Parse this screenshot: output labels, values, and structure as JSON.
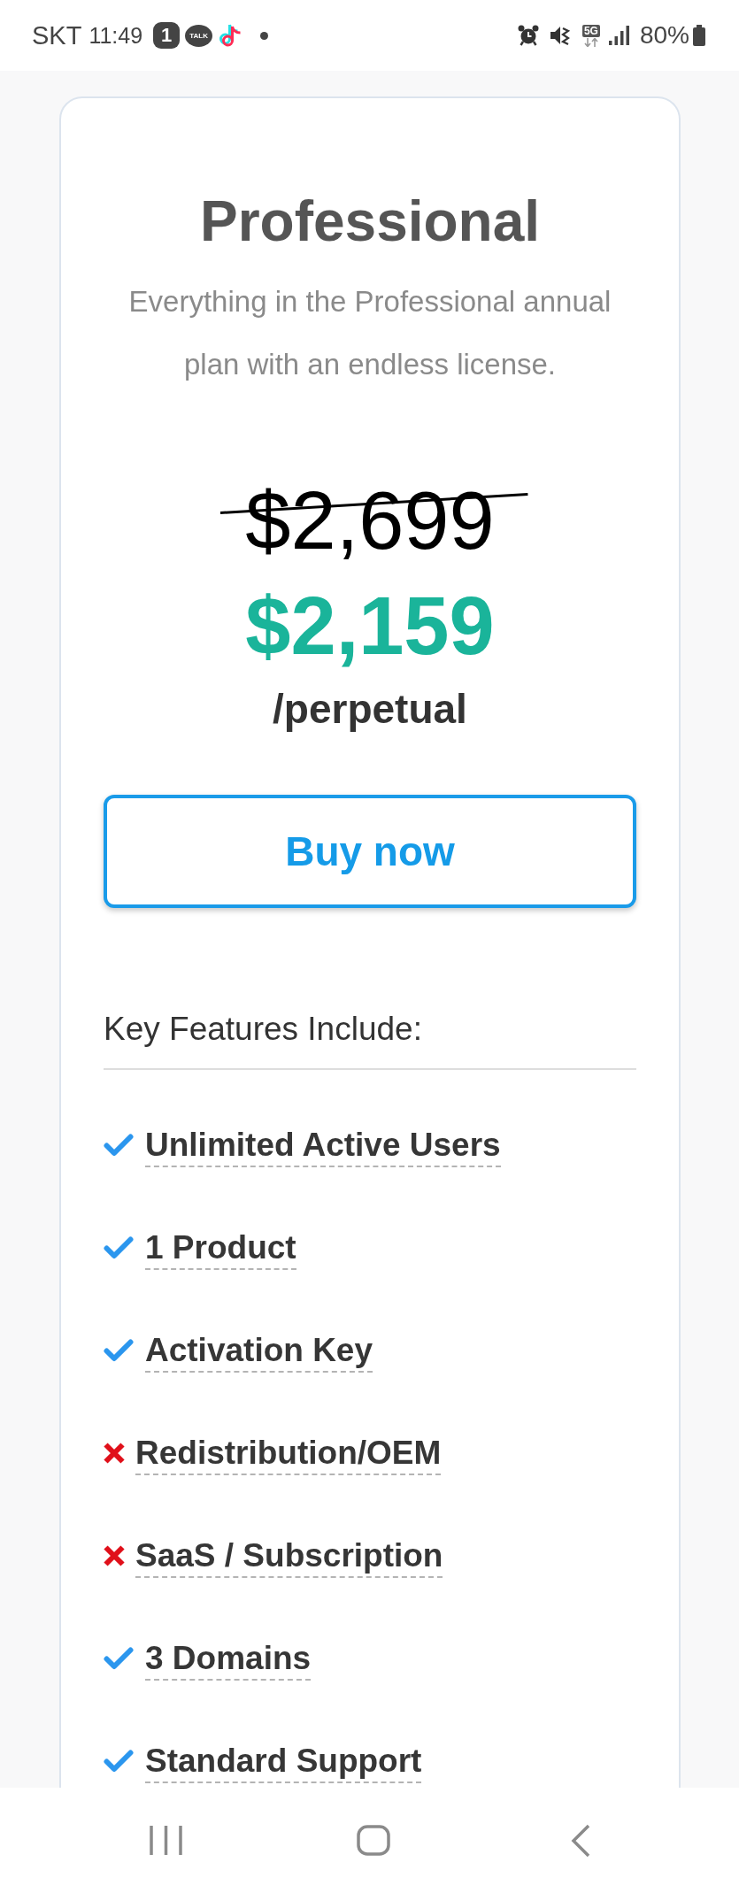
{
  "status_bar": {
    "carrier": "SKT",
    "time": "11:49",
    "notifications": [
      {
        "kind": "badge",
        "label": "1"
      },
      {
        "kind": "chat",
        "label": "TALK"
      },
      {
        "kind": "music"
      },
      {
        "kind": "dot"
      }
    ],
    "network": "5G",
    "battery": "80%"
  },
  "plan": {
    "title": "Professional",
    "description": "Everything in the Professional annual plan with an endless license.",
    "original_price": {
      "text": "$2,699",
      "struck": true
    },
    "price": "$2,159",
    "period": "/perpetual",
    "button": "Buy now"
  },
  "features": {
    "heading": "Key Features Include:",
    "items": [
      {
        "label": "Unlimited Active Users",
        "included": true
      },
      {
        "label": "1 Product",
        "included": true
      },
      {
        "label": "Activation Key",
        "included": true
      },
      {
        "label": "Redistribution/OEM",
        "included": false
      },
      {
        "label": "SaaS / Subscription",
        "included": false
      },
      {
        "label": "3 Domains",
        "included": true
      },
      {
        "label": "Standard Support",
        "included": true
      }
    ]
  }
}
